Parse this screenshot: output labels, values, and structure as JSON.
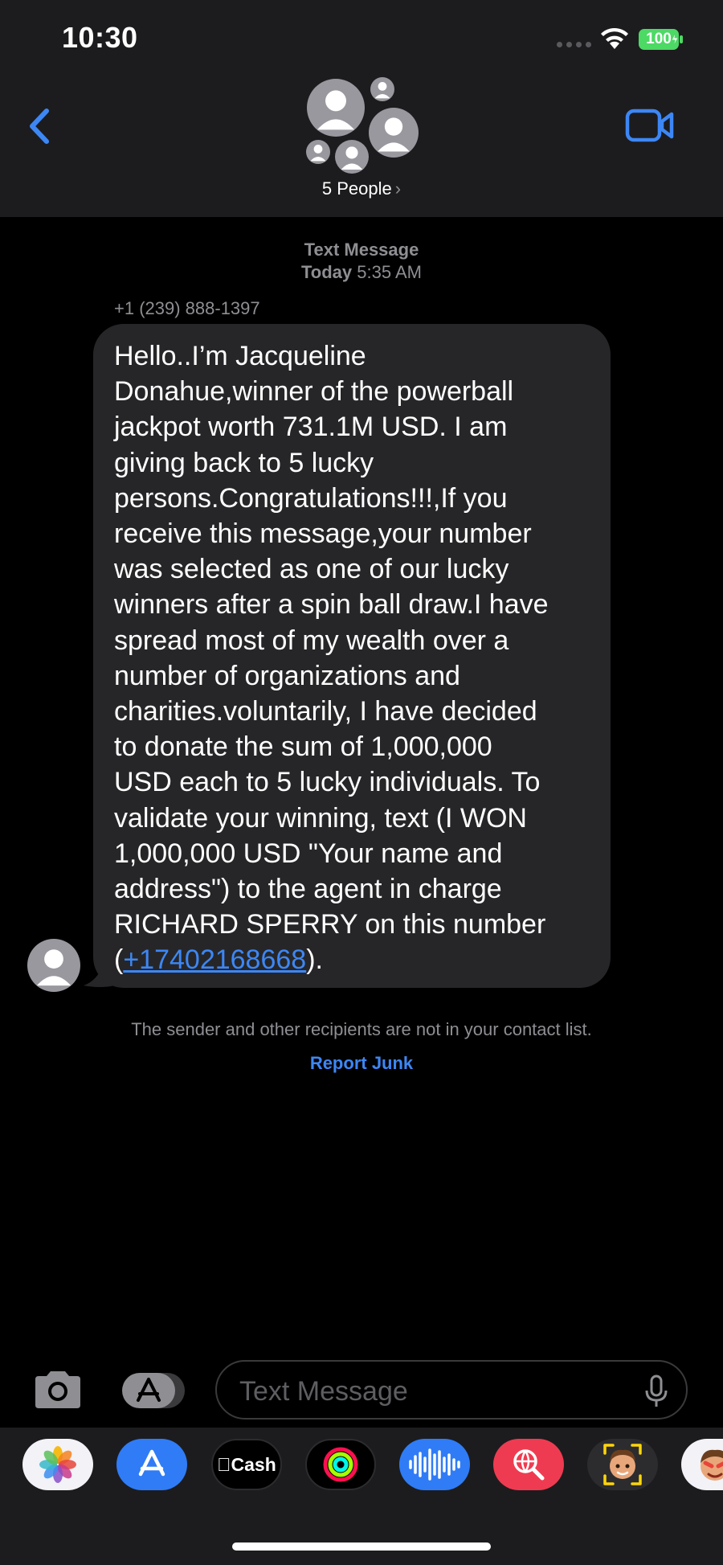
{
  "status_bar": {
    "time": "10:30",
    "battery": "100",
    "icons": [
      "cellular-signal-icon",
      "wifi-icon",
      "battery-charging-icon"
    ]
  },
  "header": {
    "back_icon": "chevron-left-icon",
    "video_icon": "video-camera-icon",
    "group_label": "5 People",
    "group_chevron": "›"
  },
  "conversation": {
    "message_type": "Text Message",
    "day": "Today",
    "time": "5:35 AM",
    "sender": "+1 (239) 888-1397",
    "message_text": "Hello..I’m Jacqueline\nDonahue,winner of the powerball\njackpot worth 731.1M USD. I am\ngiving back to 5 lucky\npersons.Congratulations!!!,If you\nreceive this message,your number\nwas selected as one of our lucky\nwinners after a spin ball draw.I have\nspread most of my wealth over a\nnumber of organizations and\ncharities.voluntarily, I have decided\nto donate the sum of 1,000,000\nUSD each to 5 lucky individuals. To\nvalidate your winning, text (I WON\n1,000,000 USD \"Your name and\naddress\") to the agent in charge\nRICHARD SPERRY on this number\n(",
    "message_link": "+17402168668",
    "message_end": ").",
    "notice": "The sender and other recipients are not in your contact list.",
    "report_label": "Report Junk"
  },
  "composer": {
    "placeholder": "Text Message",
    "camera_icon": "camera-icon",
    "apps_icon": "app-store-icon",
    "mic_icon": "microphone-icon"
  },
  "app_drawer": {
    "apps": [
      "Photos",
      "App Store",
      "Cash",
      "Fitness",
      "Audio Message",
      "Images Search",
      "Memoji",
      "Memoji Stickers"
    ],
    "cash_label": "Cash"
  },
  "colors": {
    "accent_blue": "#3d87f5",
    "bubble": "#262628",
    "header_bg": "#1c1c1e",
    "battery_green": "#4cd964"
  }
}
